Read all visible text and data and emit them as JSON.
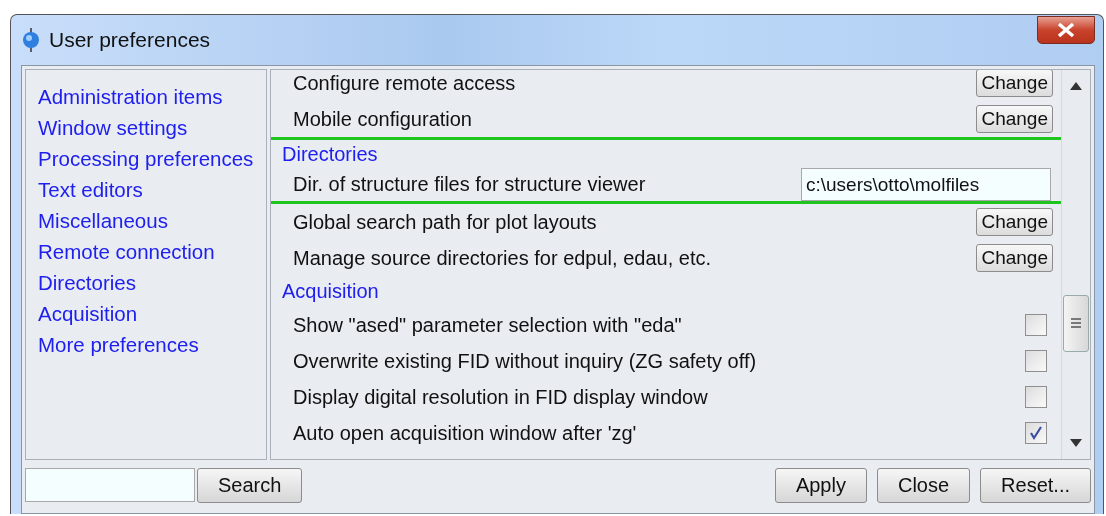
{
  "window": {
    "title": "User preferences"
  },
  "sidebar": {
    "items": [
      "Administration items",
      "Window settings",
      "Processing preferences",
      "Text editors",
      "Miscellaneous",
      "Remote connection",
      "Directories",
      "Acquisition",
      "More preferences"
    ]
  },
  "entries": [
    {
      "kind": "button",
      "label": "Configure remote access",
      "button": "Change",
      "highlighted": false
    },
    {
      "kind": "button",
      "label": "Mobile configuration",
      "button": "Change",
      "highlighted": false
    },
    {
      "kind": "heading",
      "label": "Directories",
      "highlighted": true
    },
    {
      "kind": "field",
      "label": "Dir. of structure files for structure viewer",
      "value": "c:\\users\\otto\\molfiles",
      "highlighted": true
    },
    {
      "kind": "button",
      "label": "Global search path for plot layouts",
      "button": "Change",
      "highlighted": false
    },
    {
      "kind": "button",
      "label": "Manage source directories for edpul, edau, etc.",
      "button": "Change",
      "highlighted": false
    },
    {
      "kind": "heading",
      "label": "Acquisition",
      "highlighted": false
    },
    {
      "kind": "checkbox",
      "label": "Show \"ased\" parameter selection with \"eda\"",
      "checked": false,
      "highlighted": false
    },
    {
      "kind": "checkbox",
      "label": "Overwrite existing FID without inquiry (ZG safety off)",
      "checked": false,
      "highlighted": false
    },
    {
      "kind": "checkbox",
      "label": "Display digital resolution in FID display window",
      "checked": false,
      "highlighted": false
    },
    {
      "kind": "checkbox",
      "label": "Auto open acquisition window after 'zg'",
      "checked": true,
      "highlighted": false
    }
  ],
  "footer": {
    "search_button": "Search",
    "buttons": [
      "Apply",
      "Close",
      "Reset..."
    ]
  }
}
